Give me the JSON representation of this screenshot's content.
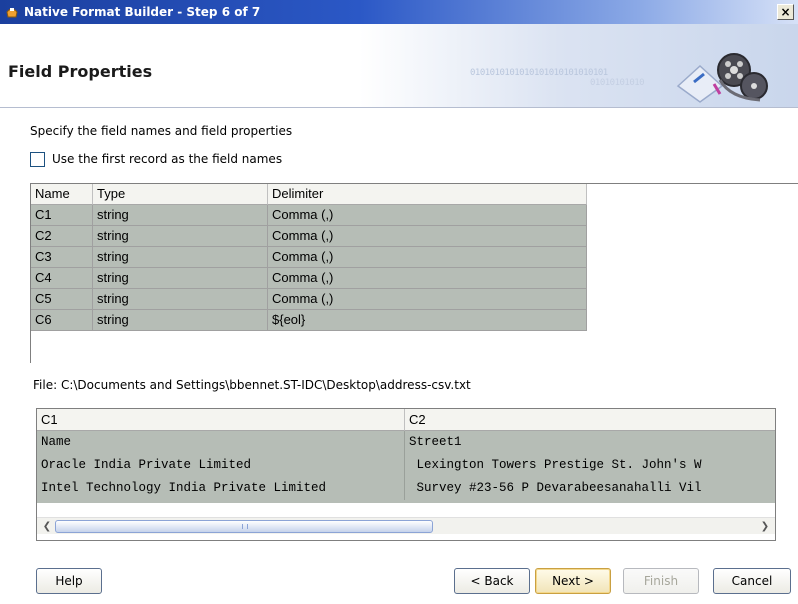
{
  "window": {
    "title": "Native Format Builder - Step 6 of 7",
    "close_label": "×"
  },
  "header": {
    "page_title": "Field Properties",
    "binary_text_1": "0101010101010101010101010101",
    "binary_text_2": "01010101010"
  },
  "instructions": "Specify the field names and field properties",
  "use_first_record": {
    "label": "Use the first record as the field names",
    "checked": false
  },
  "field_table": {
    "columns": [
      "Name",
      "Type",
      "Delimiter"
    ],
    "rows": [
      {
        "name": "C1",
        "type": "string",
        "delimiter": "Comma (,)"
      },
      {
        "name": "C2",
        "type": "string",
        "delimiter": "Comma (,)"
      },
      {
        "name": "C3",
        "type": "string",
        "delimiter": "Comma (,)"
      },
      {
        "name": "C4",
        "type": "string",
        "delimiter": "Comma (,)"
      },
      {
        "name": "C5",
        "type": "string",
        "delimiter": "Comma (,)"
      },
      {
        "name": "C6",
        "type": "string",
        "delimiter": "${eol}"
      }
    ]
  },
  "file_label": "File: C:\\Documents and Settings\\bbennet.ST-IDC\\Desktop\\address-csv.txt",
  "preview_table": {
    "columns": [
      "C1",
      "C2"
    ],
    "rows": [
      {
        "c1": "Name",
        "c2": "Street1"
      },
      {
        "c1": "Oracle India Private Limited",
        "c2": " Lexington Towers Prestige St. John's W"
      },
      {
        "c1": "Intel Technology India Private Limited",
        "c2": " Survey #23-56 P Devarabeesanahalli Vil"
      }
    ]
  },
  "buttons": {
    "help": "Help",
    "back": "< Back",
    "next": "Next >",
    "finish": "Finish",
    "cancel": "Cancel"
  },
  "colors": {
    "titlebar": "#2b58c6",
    "selected_row": "#b6bdb6",
    "primary_button_border": "#c9a042"
  }
}
